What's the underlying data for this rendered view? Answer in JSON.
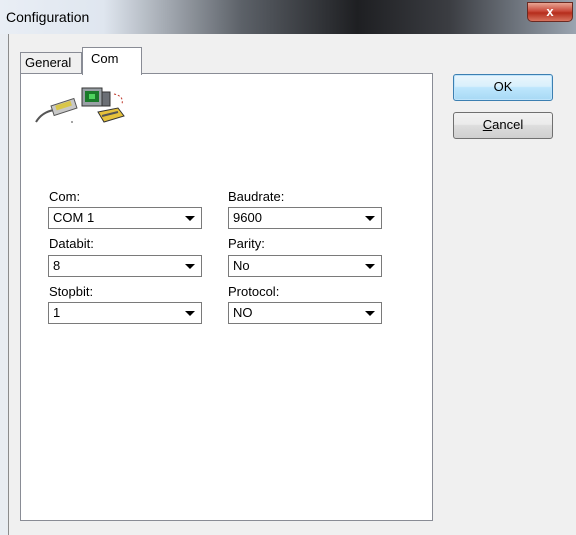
{
  "window": {
    "title": "Configuration",
    "close_glyph": "x"
  },
  "tabs": [
    {
      "label": "General",
      "selected": false
    },
    {
      "label": "Com",
      "selected": true
    }
  ],
  "buttons": {
    "ok_label": "OK",
    "cancel_mnemonic": "C",
    "cancel_rest": "ancel"
  },
  "icon": "serial-port-connection-icon",
  "fields": {
    "com": {
      "label": "Com:",
      "value": "COM 1"
    },
    "baudrate": {
      "label": "Baudrate:",
      "value": "9600"
    },
    "databit": {
      "label": "Databit:",
      "value": "8"
    },
    "parity": {
      "label": "Parity:",
      "value": "No"
    },
    "stopbit": {
      "label": "Stopbit:",
      "value": "1"
    },
    "protocol": {
      "label": "Protocol:",
      "value": "NO"
    }
  }
}
